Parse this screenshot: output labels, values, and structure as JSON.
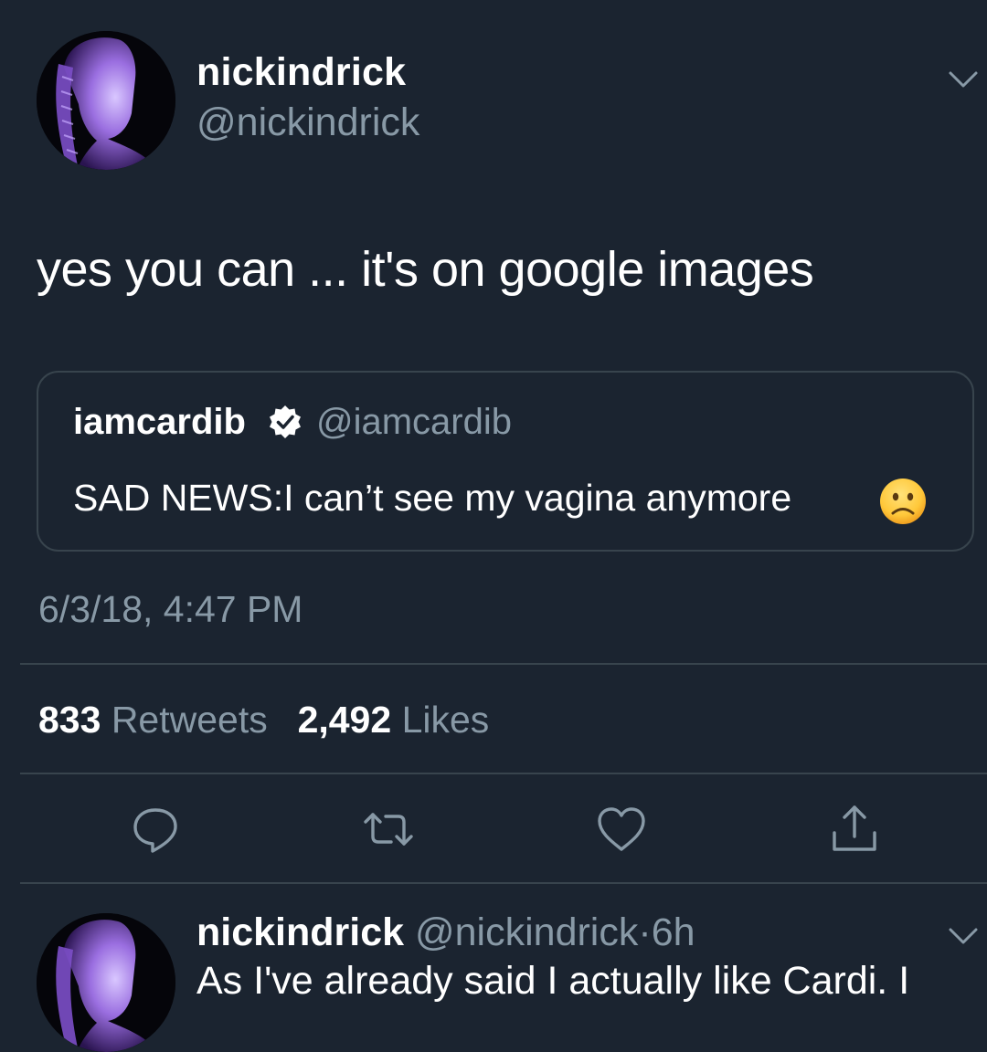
{
  "tweet": {
    "display_name": "nickindrick",
    "handle": "@nickindrick",
    "text": "yes you can ... it's on google images",
    "timestamp": "6/3/18, 4:47 PM"
  },
  "quoted_tweet": {
    "display_name": "iamcardib",
    "handle": "@iamcardib",
    "verified": true,
    "text": "SAD NEWS:I can’t see my vagina anymore",
    "emoji": "frowning-face-emoji"
  },
  "stats": {
    "retweets_count": "833",
    "retweets_label": "Retweets",
    "likes_count": "2,492",
    "likes_label": "Likes"
  },
  "actions": [
    {
      "icon": "reply-icon"
    },
    {
      "icon": "retweet-icon"
    },
    {
      "icon": "like-heart-icon"
    },
    {
      "icon": "share-icon"
    }
  ],
  "reply": {
    "display_name": "nickindrick",
    "handle": "@nickindrick",
    "separator": "·",
    "time": "6h",
    "text_partial": "As I've already said I actually like Cardi. I"
  },
  "colors": {
    "background": "#1b2430",
    "secondary_text": "#8899a6",
    "border": "#38444d",
    "primary_text": "#ffffff"
  }
}
